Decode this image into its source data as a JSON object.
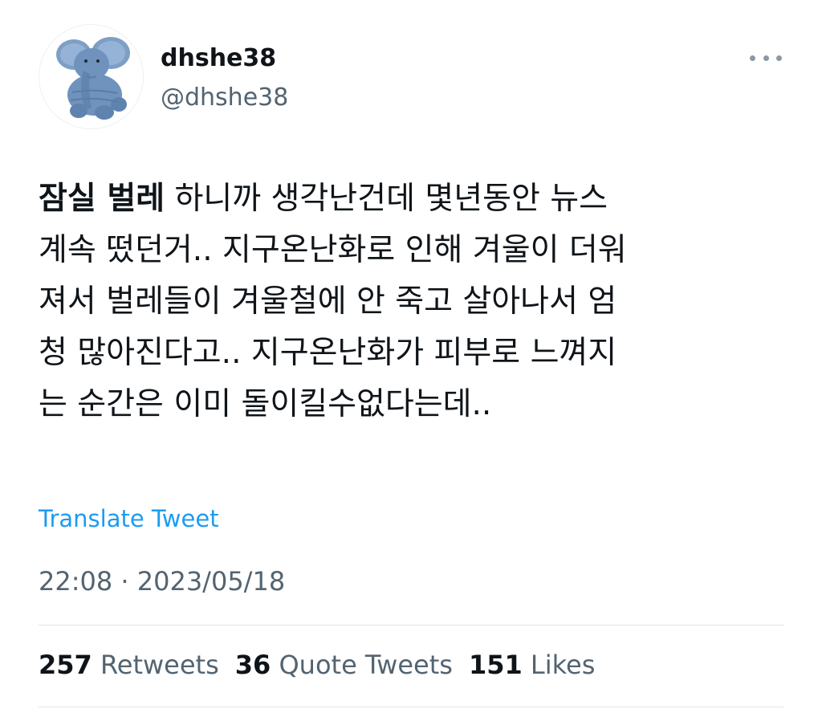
{
  "user": {
    "display_name": "dhshe38",
    "handle": "@dhshe38",
    "avatar_icon": "stuffed-elephant-avatar"
  },
  "menu": {
    "icon": "more-horizontal-icon"
  },
  "tweet": {
    "highlight": "잠실 벌레",
    "lines": [
      " 하니까 생각난건데 몇년동안 뉴스",
      "계속 떴던거.. 지구온난화로 인해 겨울이 더워",
      "져서 벌레들이 겨울철에 안 죽고 살아나서 엄",
      "청 많아진다고.. 지구온난화가 피부로 느껴지",
      "는 순간은 이미 돌이킬수없다는데.."
    ],
    "translate_label": "Translate Tweet",
    "timestamp": "22:08 · 2023/05/18"
  },
  "stats": {
    "retweets_count": "257",
    "retweets_label": "Retweets",
    "quotes_count": "36",
    "quotes_label": "Quote Tweets",
    "likes_count": "151",
    "likes_label": "Likes"
  },
  "colors": {
    "link": "#1d9bf0",
    "secondary_text": "#536471",
    "primary_text": "#0f1419",
    "avatar_elephant": "#6f93bd"
  }
}
